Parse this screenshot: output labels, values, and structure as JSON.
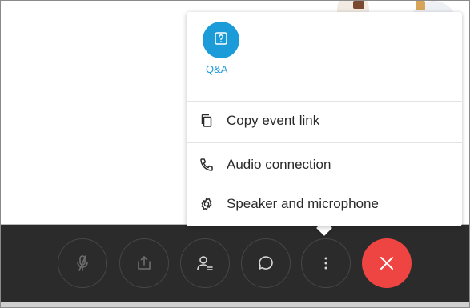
{
  "menu": {
    "qa": {
      "label": "Q&A",
      "icon": "question-icon"
    },
    "items": [
      {
        "label": "Copy event link",
        "icon": "copy-icon"
      },
      {
        "label": "Audio connection",
        "icon": "phone-icon"
      },
      {
        "label": "Speaker and microphone",
        "icon": "gear-icon"
      }
    ]
  },
  "toolbar": {
    "buttons": [
      {
        "name": "mute",
        "icon": "microphone-muted-icon"
      },
      {
        "name": "share",
        "icon": "share-icon"
      },
      {
        "name": "participants",
        "icon": "participants-icon"
      },
      {
        "name": "chat",
        "icon": "chat-icon"
      },
      {
        "name": "more",
        "icon": "more-options-icon"
      },
      {
        "name": "leave",
        "icon": "close-icon"
      }
    ]
  },
  "colors": {
    "accent": "#1b9bd8",
    "end_call": "#ef4542",
    "toolbar_bg": "#2b2b2b"
  }
}
